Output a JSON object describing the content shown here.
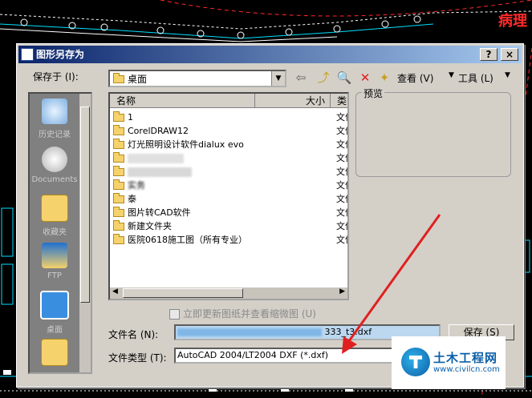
{
  "background": {
    "corner_label": "病理"
  },
  "dialog": {
    "title": "图形另存为",
    "help_btn": "?",
    "close_btn": "×"
  },
  "toolbar": {
    "save_in_label": "保存于 (I):",
    "save_in_value": "桌面",
    "view_label": "查看 (V)",
    "tools_label": "工具 (L)"
  },
  "places": [
    {
      "label": "历史记录",
      "icon": "history-icon"
    },
    {
      "label": "Documents",
      "icon": "documents-search-icon"
    },
    {
      "label": "收藏夹",
      "icon": "favorites-folder-icon"
    },
    {
      "label": "FTP",
      "icon": "ftp-icon"
    },
    {
      "label": "桌面",
      "icon": "desktop-icon"
    },
    {
      "label": "",
      "icon": "buzzsaw-icon"
    }
  ],
  "filelist": {
    "columns": [
      "名称",
      "大小",
      "类"
    ],
    "rows": [
      {
        "name": "1",
        "type": "文件"
      },
      {
        "name": "CorelDRAW12",
        "type": "文件"
      },
      {
        "name": "灯光照明设计软件dialux evo",
        "type": "文件"
      },
      {
        "name": "",
        "type": "文件"
      },
      {
        "name": "",
        "type": "文件"
      },
      {
        "name": "实务",
        "type": "文件"
      },
      {
        "name": "泰",
        "type": "文件"
      },
      {
        "name": "图片转CAD软件",
        "type": "文件"
      },
      {
        "name": "新建文件夹",
        "type": "文件"
      },
      {
        "name": "医院0618施工图（所有专业）",
        "type": "文件"
      }
    ]
  },
  "preview": {
    "label": "预览"
  },
  "options": {
    "update_thumbnail_label": "立即更新图纸并查看缩微图 (U)"
  },
  "filename": {
    "label": "文件名 (N):",
    "value": "333_t3.dxf"
  },
  "filetype": {
    "label": "文件类型 (T):",
    "value": "AutoCAD 2004/LT2004 DXF (*.dxf)"
  },
  "buttons": {
    "save": "保存 (S)"
  },
  "watermark": {
    "name": "土木工程网",
    "url": "www.civilcn.com"
  },
  "colors": {
    "title_start": "#0a246a",
    "title_end": "#a6caf0",
    "dialog_bg": "#d4d0c8",
    "arrow": "#e02020"
  }
}
